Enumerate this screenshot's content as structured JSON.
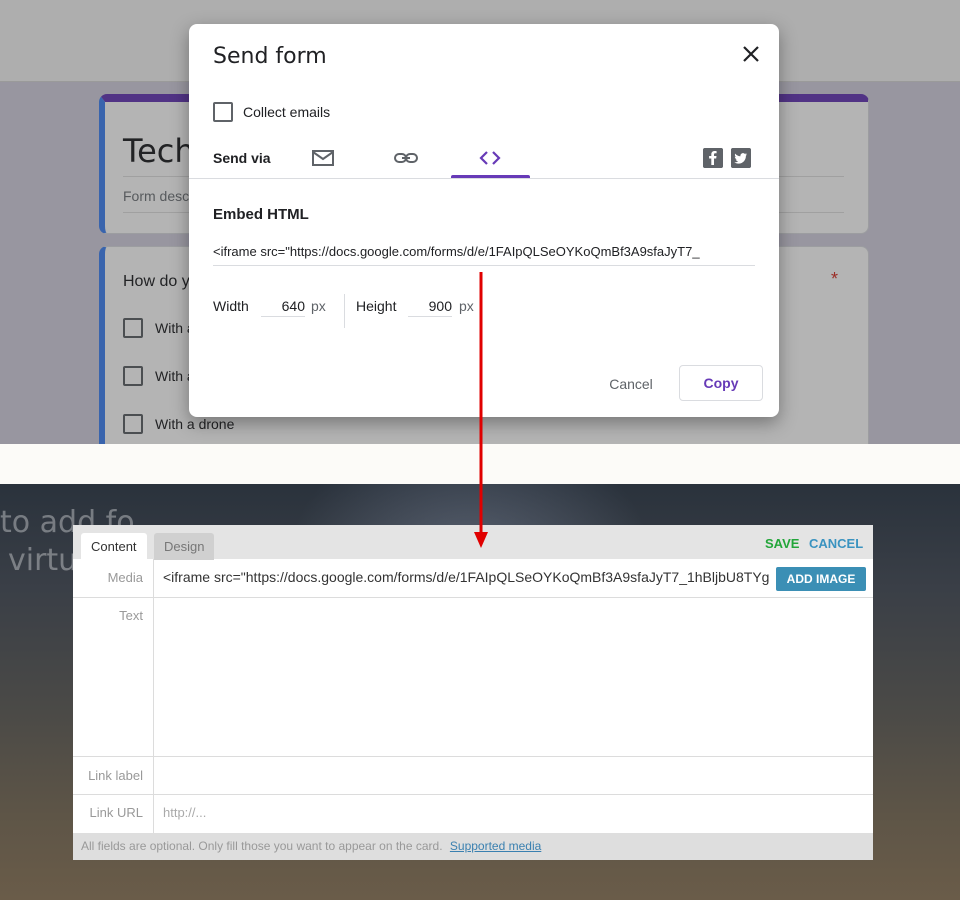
{
  "form": {
    "title": "Tech",
    "description_placeholder": "Form desc",
    "question": "How do y",
    "required_mark": "*",
    "options": [
      "With a",
      "With a",
      "With a drone"
    ]
  },
  "modal": {
    "title": "Send form",
    "collect_emails": "Collect emails",
    "send_via": "Send via",
    "embed_heading": "Embed HTML",
    "embed_code": "<iframe src=\"https://docs.google.com/forms/d/e/1FAIpQLSeOYKoQmBf3A9sfaJyT7_",
    "width_label": "Width",
    "width_value": "640",
    "height_label": "Height",
    "height_value": "900",
    "unit": "px",
    "cancel": "Cancel",
    "copy": "Copy"
  },
  "background": {
    "hero_line1": "to add fo",
    "hero_line2": "virtu",
    "hero_bang": "!"
  },
  "editor": {
    "tabs": [
      "Content",
      "Design"
    ],
    "save": "SAVE",
    "cancel": "CANCEL",
    "labels": {
      "media": "Media",
      "text": "Text",
      "link_label": "Link label",
      "link_url": "Link URL"
    },
    "media_value": "<iframe src=\"https://docs.google.com/forms/d/e/1FAIpQLSeOYKoQmBf3A9sfaJyT7_1hBljbU8TYg",
    "add_image": "ADD IMAGE",
    "url_placeholder": "http://...",
    "footer_note": "All fields are optional. Only fill those you want to appear on the card.",
    "footer_link": "Supported media"
  },
  "colors": {
    "accent_purple": "#673ab7",
    "arrow_red": "#e00000",
    "save_green": "#23a63a",
    "cancel_blue": "#3a93c0"
  }
}
